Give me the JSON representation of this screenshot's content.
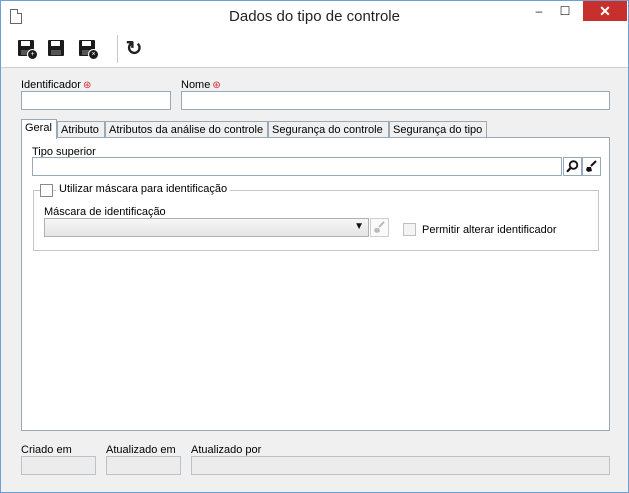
{
  "window": {
    "title": "Dados do tipo de controle",
    "minimize": "–",
    "maximize": "☐",
    "close": "✕"
  },
  "toolbar": {
    "buttons": [
      {
        "name": "save-and-new-button",
        "icon": "floppy-plus-icon"
      },
      {
        "name": "save-button",
        "icon": "floppy-icon"
      },
      {
        "name": "save-and-close-button",
        "icon": "floppy-x-icon"
      },
      {
        "name": "refresh-button",
        "icon": "refresh-icon"
      }
    ],
    "refresh_glyph": "↻"
  },
  "form": {
    "identificador_label": "Identificador",
    "identificador_value": "",
    "nome_label": "Nome",
    "nome_value": "",
    "required_mark": "⊛"
  },
  "tabs": [
    {
      "label": "Geral",
      "active": true
    },
    {
      "label": "Atributo",
      "active": false
    },
    {
      "label": "Atributos da análise do controle",
      "active": false
    },
    {
      "label": "Segurança do controle",
      "active": false
    },
    {
      "label": "Segurança do tipo",
      "active": false
    }
  ],
  "geral": {
    "tipo_superior_label": "Tipo superior",
    "tipo_superior_value": "",
    "utilizar_mascara_label": "Utilizar máscara para identificação",
    "utilizar_mascara_checked": false,
    "mascara_label": "Máscara de identificação",
    "mascara_value": "",
    "permitir_alterar_label": "Permitir alterar identificador",
    "permitir_alterar_checked": false
  },
  "footer": {
    "criado_em_label": "Criado em",
    "criado_em_value": "",
    "atualizado_em_label": "Atualizado em",
    "atualizado_em_value": "",
    "atualizado_por_label": "Atualizado por",
    "atualizado_por_value": ""
  }
}
